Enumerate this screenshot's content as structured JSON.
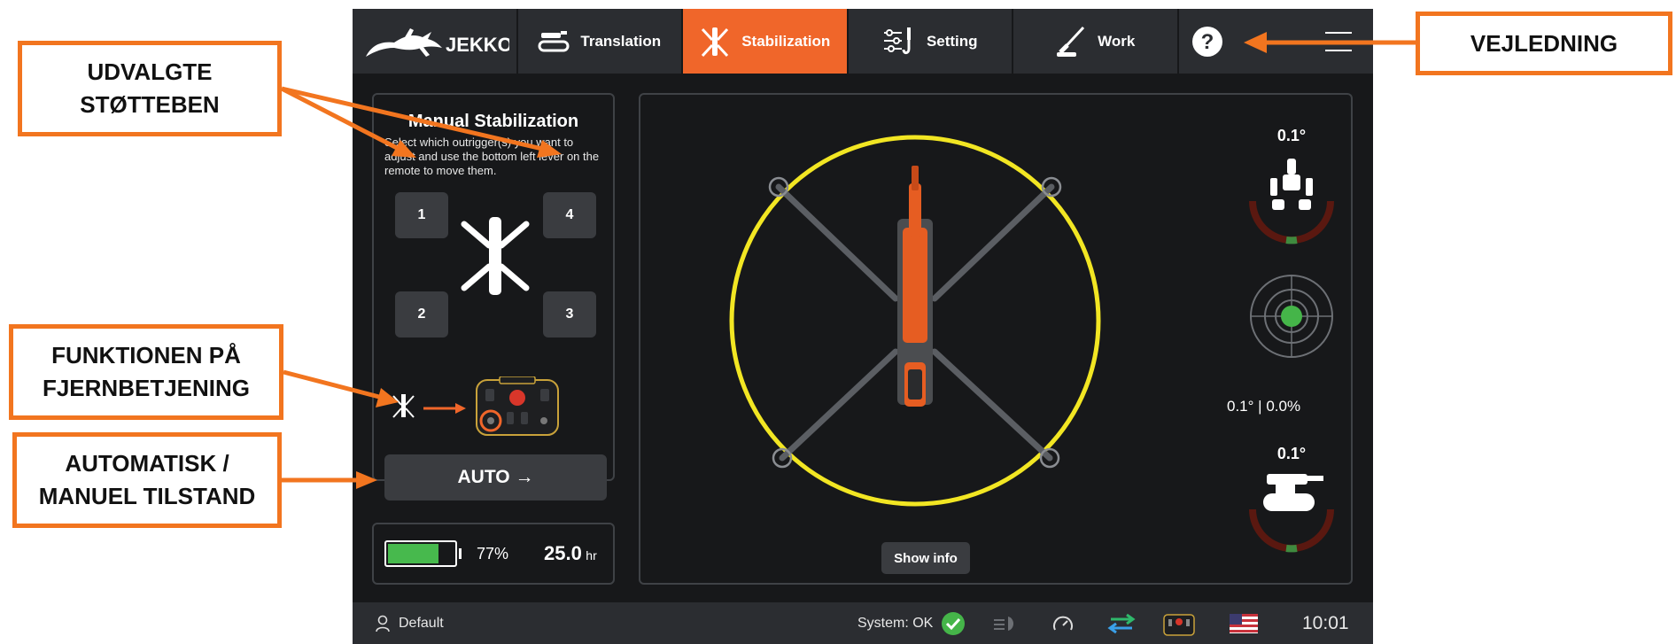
{
  "header": {
    "logo_text": "JEKKO",
    "tabs": [
      {
        "label": "Translation",
        "icon": "tracks-icon",
        "active": false
      },
      {
        "label": "Stabilization",
        "icon": "outrigger-icon",
        "active": true
      },
      {
        "label": "Setting",
        "icon": "sliders-hook-icon",
        "active": false
      },
      {
        "label": "Work",
        "icon": "crane-boom-icon",
        "active": false
      }
    ],
    "help_icon": "help-icon",
    "menu_icon": "hamburger-menu-icon"
  },
  "stabilization_panel": {
    "title": "Manual Stabilization",
    "description": "Select which outrigger(s) you want to adjust and use the bottom left lever on the remote to move them.",
    "outriggers": [
      "1",
      "4",
      "2",
      "3"
    ],
    "auto_button": "AUTO →"
  },
  "battery": {
    "percent_text": "77%",
    "level": 0.77,
    "hours": "25.0",
    "hours_unit": "hr"
  },
  "main_view": {
    "show_info_button": "Show info",
    "roll_angle": "0.1°",
    "level_reading_angle": "0.1°",
    "level_reading_sep": "|",
    "level_reading_percent": "0.0%",
    "pitch_angle": "0.1°"
  },
  "status_bar": {
    "user": "Default",
    "system_status": "System: OK",
    "time": "10:01",
    "icons": [
      "user-icon",
      "ok-check-icon",
      "lights-icon",
      "speedometer-icon",
      "transfer-arrows-icon",
      "remote-control-icon",
      "us-flag-icon"
    ]
  },
  "annotations": {
    "selected_outriggers": [
      "UDVALGTE",
      "STØTTEBEN"
    ],
    "remote_function": [
      "FUNKTIONEN PÅ",
      "FJERNBETJENING"
    ],
    "auto_manual_mode": [
      "AUTOMATISK /",
      "MANUEL TILSTAND"
    ],
    "guide": [
      "VEJLEDNING"
    ]
  },
  "colors": {
    "accent": "#f0662a",
    "callout_border": "#f2751f",
    "level_circle": "#f2e623",
    "level_ok": "#45b549",
    "battery_fill": "#47b94d",
    "panel_bg": "#17181a",
    "bar_bg": "#2b2d31"
  }
}
